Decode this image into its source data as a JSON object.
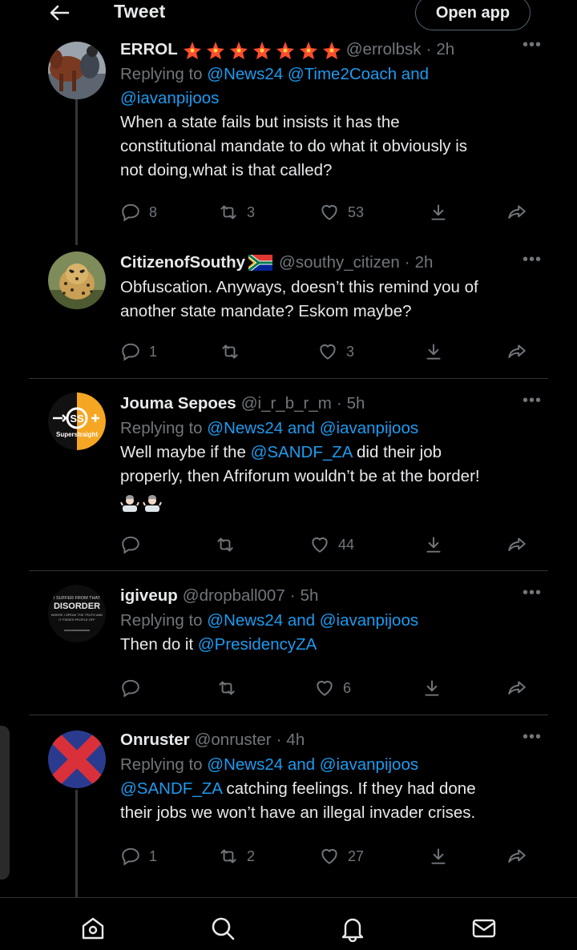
{
  "header": {
    "title": "Tweet",
    "open_app_label": "Open app"
  },
  "tweets": [
    {
      "name": "ERROL",
      "name_decoration": "★★★★★★★",
      "handle": "@errolbsk",
      "dot": "·",
      "time": "2h",
      "replying_prefix": "Replying to",
      "replying_links": "@News24 @Time2Coach and",
      "replying_links_2": "@iavanpijoos",
      "text_1": "When a state fails but insists it has the",
      "text_2": "constitutional mandate to do what it obviously is",
      "text_3": "not doing,what is that called?",
      "replies": "8",
      "retweets": "3",
      "likes": "53"
    },
    {
      "name": "CitizenofSouthy",
      "handle": "@southy_citizen",
      "dot": "·",
      "time": "2h",
      "text_1": "Obfuscation. Anyways, doesn’t this remind you of",
      "text_2": "another state mandate? Eskom maybe?",
      "replies": "1",
      "retweets": "",
      "likes": "3"
    },
    {
      "name": "Jouma Sepoes",
      "handle": "@i_r_b_r_m",
      "dot": "·",
      "time": "5h",
      "avatar_text": "Superstraight",
      "replying_prefix": "Replying to",
      "replying_links": "@News24 and @iavanpijoos",
      "text_1_pre": "Well maybe if the ",
      "text_1_mention": "@SANDF_ZA",
      "text_1_post": " did their job",
      "text_2": "properly, then Afriforum wouldn’t be at the border!",
      "replies": "",
      "retweets": "",
      "likes": "44"
    },
    {
      "name": "igiveup",
      "handle": "@dropball007",
      "dot": "·",
      "time": "5h",
      "avatar_line_1": "I SUFFER FROM THAT",
      "avatar_line_2": "DISORDER",
      "avatar_line_3": "WHERE I SPEAK THE TRUTH AND",
      "avatar_line_4": "IT PISSES PEOPLE OFF",
      "replying_prefix": "Replying to",
      "replying_links": "@News24 and @iavanpijoos",
      "text_1_pre": "Then do it ",
      "text_1_mention": "@PresidencyZA",
      "replies": "",
      "retweets": "",
      "likes": "6"
    },
    {
      "name": "Onruster",
      "handle": "@onruster",
      "dot": "·",
      "time": "4h",
      "replying_prefix": "Replying to",
      "replying_links": "@News24 and @iavanpijoos",
      "text_1_mention": "@SANDF_ZA",
      "text_1_post": " catching feelings. If they had done",
      "text_2": "their jobs we won’t have an illegal invader crises.",
      "replies": "1",
      "retweets": "2",
      "likes": "27"
    }
  ],
  "more_label": "•••",
  "colors": {
    "accent": "#1d9bf0",
    "muted": "#71767b",
    "text": "#e7e9ea",
    "background": "#000000"
  }
}
